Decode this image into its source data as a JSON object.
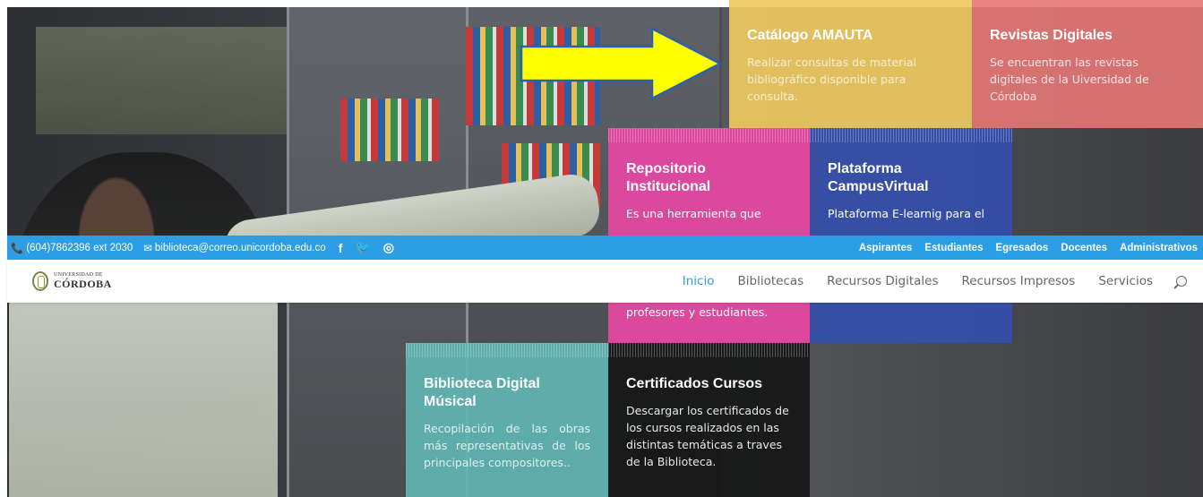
{
  "topbar": {
    "phone": "(604)7862396 ext 2030",
    "email": "biblioteca@correo.unicordoba.edu.co",
    "social": [
      {
        "icon": "facebook-icon",
        "glyph": "f"
      },
      {
        "icon": "twitter-icon",
        "glyph": "🐦"
      },
      {
        "icon": "instagram-icon",
        "glyph": "◎"
      }
    ],
    "links": [
      "Aspirantes",
      "Estudiantes",
      "Egresados",
      "Docentes",
      "Administrativos"
    ]
  },
  "navbar": {
    "logo_small": "UNIVERSIDAD DE",
    "logo_big": "CÓRDOBA",
    "menu": [
      "Inicio",
      "Bibliotecas",
      "Recursos Digitales",
      "Recursos Impresos",
      "Servicios"
    ],
    "active": "Inicio"
  },
  "tiles": {
    "amauta": {
      "title": "Catálogo AMAUTA",
      "description": "Realizar consultas de material bibliográfico disponible para consulta."
    },
    "revistas": {
      "title": "Revistas Digitales",
      "description": "Se encuentran las revistas digitales de la Uiversidad de Córdoba"
    },
    "repositorio": {
      "title": "Repositorio Institucional",
      "description": "Es una herramienta que",
      "description_lower": "profesores y estudiantes."
    },
    "campus": {
      "title": "Plataforma CampusVirtual",
      "description": "Plataforma E-learnig para el"
    },
    "musical": {
      "title": "Biblioteca Digital Músical",
      "description": "Recopilación de las obras más representativas de los principales compositores.."
    },
    "certificados": {
      "title": "Certificados Cursos",
      "description": "Descargar los certificados de los cursos realizados en las distintas temáticas  a traves de la Biblioteca."
    }
  },
  "colors": {
    "accent": "#2b9ee6",
    "amauta": "#eec95f",
    "revistas": "#e57876",
    "repositorio": "#e448a0",
    "campus": "#364eaa",
    "musical": "#61b5b2",
    "certificados": "#161616",
    "arrow_fill": "#ffff00"
  }
}
